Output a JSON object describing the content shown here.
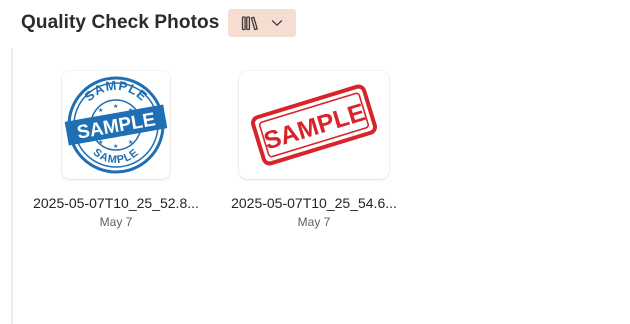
{
  "header": {
    "title": "Quality Check Photos",
    "view_icon": "library-icon",
    "dropdown_icon": "chevron-down-icon",
    "button_bg": "#f6ddd2"
  },
  "files": [
    {
      "name": "2025-05-07T10_25_52.8...",
      "date": "May 7",
      "stamp": {
        "color": "#1f6fb4",
        "text": "SAMPLE",
        "style": "round-blue-stamp"
      }
    },
    {
      "name": "2025-05-07T10_25_54.6...",
      "date": "May 7",
      "stamp": {
        "color": "#d9232a",
        "text": "SAMPLE",
        "style": "rectangular-red-stamp"
      }
    }
  ]
}
